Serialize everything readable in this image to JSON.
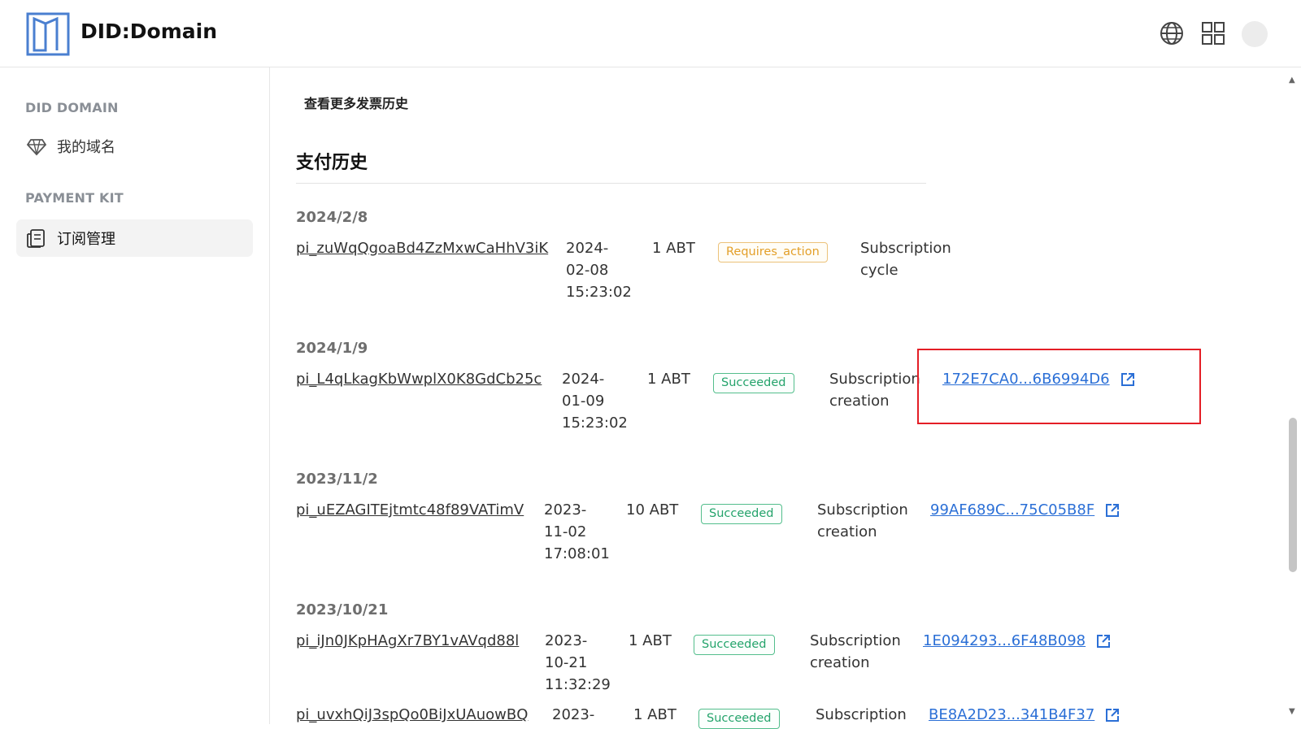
{
  "header": {
    "app_title": "DID:Domain",
    "icons": [
      "globe-icon",
      "apps-grid-icon",
      "avatar"
    ]
  },
  "sidebar": {
    "sections": [
      {
        "title": "DID DOMAIN",
        "items": [
          {
            "label": "我的域名",
            "icon": "diamond-icon"
          }
        ]
      },
      {
        "title": "PAYMENT KIT",
        "items": [
          {
            "label": "订阅管理",
            "icon": "subscription-icon",
            "active": true
          }
        ]
      }
    ]
  },
  "main": {
    "more_invoices": "查看更多发票历史",
    "payment_history_title": "支付历史",
    "payments": [
      {
        "group_date": "2024/2/8",
        "id": "pi_zuWqQgoaBd4ZzMxwCaHhV3iK",
        "datetime": [
          "2024-",
          "02-08",
          "15:23:02"
        ],
        "amount": "1 ABT",
        "status": "Requires_action",
        "description": [
          "Subscription",
          "cycle"
        ],
        "tx": ""
      },
      {
        "group_date": "2024/1/9",
        "id": "pi_L4qLkagKbWwplX0K8GdCb25c",
        "datetime": [
          "2024-",
          "01-09",
          "15:23:02"
        ],
        "amount": "1 ABT",
        "status": "Succeeded",
        "description": [
          "Subscription",
          "creation"
        ],
        "tx": "172E7CA0...6B6994D6"
      },
      {
        "group_date": "2023/11/2",
        "id": "pi_uEZAGITEjtmtc48f89VATimV",
        "datetime": [
          "2023-",
          "11-02",
          "17:08:01"
        ],
        "amount": "10 ABT",
        "status": "Succeeded",
        "description": [
          "Subscription",
          "creation"
        ],
        "tx": "99AF689C...75C05B8F"
      },
      {
        "group_date": "2023/10/21",
        "id": "pi_iJn0JKpHAgXr7BY1vAVqd88l",
        "datetime": [
          "2023-",
          "10-21",
          "11:32:29"
        ],
        "amount": "1 ABT",
        "status": "Succeeded",
        "description": [
          "Subscription",
          "creation"
        ],
        "tx": "1E094293...6F48B098"
      },
      {
        "group_date": "",
        "id": "pi_uvxhQiJ3spQo0BiJxUAuowBQ",
        "datetime": [
          "2023-"
        ],
        "amount": "1 ABT",
        "status": "Succeeded",
        "description": [
          "Subscription"
        ],
        "tx": "BE8A2D23...341B4F37"
      }
    ]
  },
  "colors": {
    "link": "#2b6fd6",
    "success": "#24a36b",
    "warning": "#e39f28",
    "highlight": "#e41e26"
  }
}
